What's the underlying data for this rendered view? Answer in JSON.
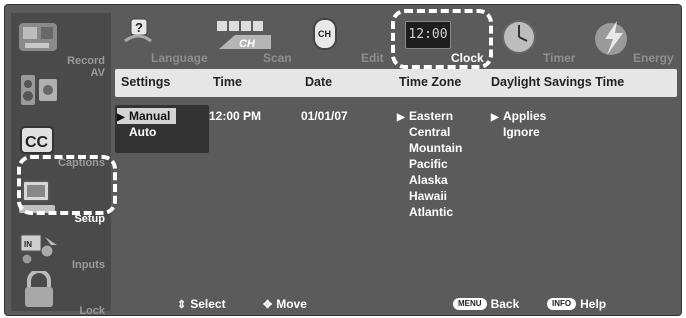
{
  "sidebar": {
    "items": [
      {
        "label": "Record",
        "icon": "record-icon"
      },
      {
        "label": "AV",
        "icon": "speakers-icon"
      },
      {
        "label": "Captions",
        "icon": "cc-icon"
      },
      {
        "label": "Setup",
        "icon": "computer-setup-icon"
      },
      {
        "label": "Inputs",
        "icon": "inputs-icon"
      },
      {
        "label": "Lock",
        "icon": "padlock-icon"
      }
    ],
    "active": "Setup"
  },
  "tabs": [
    {
      "label": "Language",
      "icon": "language-icon"
    },
    {
      "label": "Scan",
      "icon": "scan-icon"
    },
    {
      "label": "Edit",
      "icon": "channel-edit-icon"
    },
    {
      "label": "Clock",
      "icon": "clock-icon",
      "display": "12:00"
    },
    {
      "label": "Timer",
      "icon": "timer-icon"
    },
    {
      "label": "Energy",
      "icon": "energy-icon"
    }
  ],
  "header": {
    "settings": "Settings",
    "time": "Time",
    "date": "Date",
    "time_zone": "Time Zone",
    "dst": "Daylight Savings Time"
  },
  "settings_options": [
    "Manual",
    "Auto"
  ],
  "time_value": "12:00 PM",
  "date_value": "01/01/07",
  "time_zones": [
    "Eastern",
    "Central",
    "Mountain",
    "Pacific",
    "Alaska",
    "Hawaii",
    "Atlantic"
  ],
  "dst_options": [
    "Applies",
    "Ignore"
  ],
  "footer": {
    "select": "Select",
    "move": "Move",
    "menu_key": "MENU",
    "back": "Back",
    "info_key": "INFO",
    "help": "Help"
  },
  "colors": {
    "background": "#5b5b5b",
    "header": "#e6e6e6",
    "text": "#ffffff",
    "inactive": "#8e8e8e"
  }
}
